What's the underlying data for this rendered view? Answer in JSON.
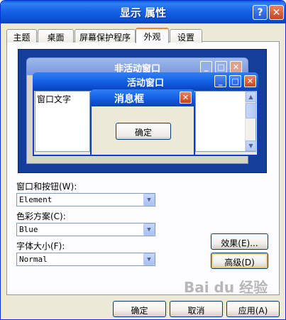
{
  "window": {
    "title": "显示 属性",
    "help_label": "?",
    "close_label": "✕"
  },
  "tabs": [
    {
      "label": "主题"
    },
    {
      "label": "桌面"
    },
    {
      "label": "屏幕保护程序"
    },
    {
      "label": "外观"
    },
    {
      "label": "设置"
    }
  ],
  "active_tab": "外观",
  "preview": {
    "inactive_title": "非活动窗口",
    "active_title": "活动窗口",
    "window_text": "窗口文字",
    "messagebox_title": "消息框",
    "messagebox_ok": "确定"
  },
  "fields": {
    "windows_buttons_label": "窗口和按钮(W):",
    "windows_buttons_value": "Element",
    "color_scheme_label": "色彩方案(C):",
    "color_scheme_value": "Blue",
    "font_size_label": "字体大小(F):",
    "font_size_value": "Normal"
  },
  "side_buttons": {
    "effects_label": "效果(E)...",
    "advanced_label": "高级(D)"
  },
  "footer": {
    "ok_label": "确定",
    "cancel_label": "取消",
    "apply_label": "应用(A)"
  },
  "watermark": "Bai du 经验",
  "colors": {
    "titlebar": "#1560e6",
    "dialog_bg": "#ece9d8",
    "preview_bg": "#133e99",
    "tab_highlight": "#e68b2c"
  },
  "icons": {
    "help": "help-icon",
    "close": "close-icon",
    "minimize": "minimize-icon",
    "maximize": "maximize-icon",
    "dropdown": "chevron-down-icon"
  }
}
